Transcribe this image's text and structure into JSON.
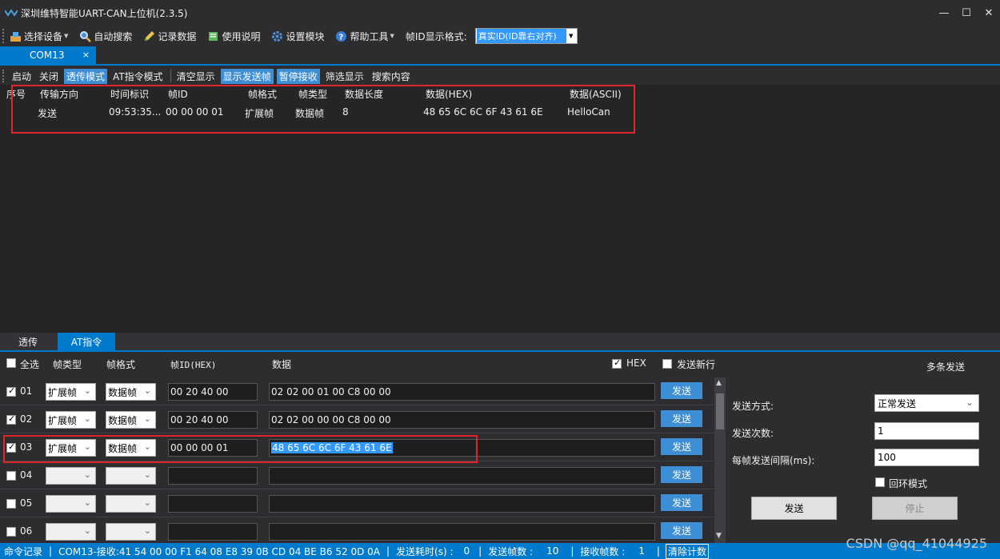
{
  "window": {
    "title": "深圳维特智能UART-CAN上位机(2.3.5)",
    "minimize": "—",
    "maximize": "☐",
    "close": "✕"
  },
  "toolbar": {
    "select_device": "选择设备",
    "auto_search": "自动搜索",
    "record_data": "记录数据",
    "usage": "使用说明",
    "setup_module": "设置模块",
    "help_tools": "帮助工具",
    "id_format_label": "帧ID显示格式:",
    "id_format_value": "真实ID(ID靠右对齐)"
  },
  "doc_tab": {
    "label": "COM13",
    "close": "×"
  },
  "sub_toolbar": {
    "start": "启动",
    "close": "关闭",
    "passthrough": "透传模式",
    "at_mode": "AT指令模式",
    "clear": "清空显示",
    "show_sent": "显示发送帧",
    "pause_recv": "暂停接收",
    "filter": "筛选显示",
    "search": "搜索内容"
  },
  "log": {
    "columns": [
      "序号",
      "传输方向",
      "时间标识",
      "帧ID",
      "帧格式",
      "帧类型",
      "数据长度",
      "数据(HEX)",
      "数据(ASCII)"
    ],
    "rows": [
      [
        "",
        "发送",
        "09:53:35...",
        "00 00 00 01",
        "扩展帧",
        "数据帧",
        "8",
        "48 65 6C 6C 6F 43 61 6E",
        "HelloCan"
      ]
    ]
  },
  "bottom_tabs": {
    "passthrough": "透传",
    "at": "AT指令"
  },
  "send_header": {
    "select_all": "全选",
    "frame_type": "帧类型",
    "frame_format": "帧格式",
    "frame_id": "帧ID(HEX)",
    "data": "数据",
    "hex": "HEX",
    "newline": "发送新行",
    "multi_send": "多条发送"
  },
  "send_rows": [
    {
      "num": "01",
      "checked": true,
      "type": "扩展帧",
      "format": "数据帧",
      "id": "00 20 40 00",
      "data": "02 02 00 01 00 C8 00 00",
      "button": "发送"
    },
    {
      "num": "02",
      "checked": true,
      "type": "扩展帧",
      "format": "数据帧",
      "id": "00 20 40 00",
      "data": "02 02 00 00 00 C8 00 00",
      "button": "发送"
    },
    {
      "num": "03",
      "checked": true,
      "type": "扩展帧",
      "format": "数据帧",
      "id": "00 00 00 01",
      "data": "48 65 6C 6C 6F 43 61 6E",
      "button": "发送"
    },
    {
      "num": "04",
      "checked": false,
      "type": "",
      "format": "",
      "id": "",
      "data": "",
      "button": "发送"
    },
    {
      "num": "05",
      "checked": false,
      "type": "",
      "format": "",
      "id": "",
      "data": "",
      "button": "发送"
    },
    {
      "num": "06",
      "checked": false,
      "type": "",
      "format": "",
      "id": "",
      "data": "",
      "button": "发送"
    }
  ],
  "multi_panel": {
    "send_mode_label": "发送方式:",
    "send_mode_value": "正常发送",
    "send_count_label": "发送次数:",
    "send_count_value": "1",
    "interval_label": "每帧发送间隔(ms):",
    "interval_value": "100",
    "loop_label": "回环模式",
    "send_button": "发送",
    "stop_button": "停止"
  },
  "statusbar": {
    "cmd_log": "命令记录",
    "recv_info": "COM13-接收:41 54 00 00 F1 64 08 E8 39 0B CD 04 BE B6 52 0D 0A",
    "send_time_label": "发送耗时(s) :",
    "send_time_value": "0",
    "send_frames_label": "发送帧数 :",
    "send_frames_value": "10",
    "recv_frames_label": "接收帧数 :",
    "recv_frames_value": "1",
    "clear_count": "清除计数",
    "separator": "|"
  },
  "watermark": "CSDN @qq_41044925",
  "colors": {
    "accent": "#007acc",
    "highlight": "#3e8ed6",
    "annotation": "#e0262b"
  }
}
